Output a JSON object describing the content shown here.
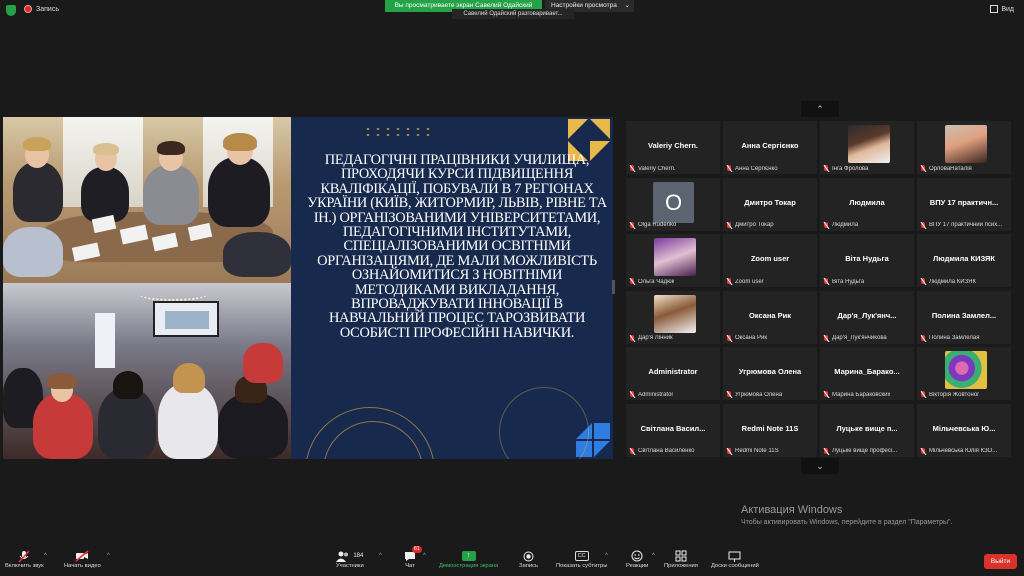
{
  "topbar": {
    "record_label": "Запись",
    "sharing_banner": "Вы просматриваете экран Савелий Одайский",
    "view_options": "Настройки просмотра",
    "speaking": "Савелий Одайский разговаривает...",
    "view_label": "Вид"
  },
  "slide": {
    "text": "Педагогічні працівники училища, проходячи курси підвищення кваліфікації, побували в 7 регіонах України (Київ, Житормир, Львів, Рівне та ін.) організованими університетами, педагогічними інститутами, спеціалізованими освітніми організаціями, де мали можливість ознайомитися з новітніми методиками викладання, впроваджувати інновації в навчальний процес таРозвивати особисті професійні навички.",
    "accent_color": "#e8b84a",
    "background_color": "#17294d"
  },
  "gallery": {
    "up_label": "⌃",
    "down_label": "⌄",
    "tiles": [
      {
        "center": "Valeriy Chern.",
        "footer": "Valeriy Chern."
      },
      {
        "center": "Анна Сергієнко",
        "footer": "Анна Сергієнко"
      },
      {
        "center": "",
        "footer": "Інга Фролова",
        "avatar": "photo"
      },
      {
        "center": "",
        "footer": "ОрловаНаталія",
        "avatar": "photo"
      },
      {
        "center": "",
        "footer": "Olga Rudenko",
        "avatar": "letter",
        "letter": "O"
      },
      {
        "center": "Дмитро Токар",
        "footer": "Дмитро Токар"
      },
      {
        "center": "Людмила",
        "footer": "Людмила"
      },
      {
        "center": "ВПУ 17 практичн...",
        "footer": "ВПУ 17 практичний псих..."
      },
      {
        "center": "",
        "footer": "Ольга Чадюк",
        "avatar": "photo"
      },
      {
        "center": "Zoom user",
        "footer": "Zoom user"
      },
      {
        "center": "Віта Нудьга",
        "footer": "Віта Нудьга"
      },
      {
        "center": "Людмила КИЗЯК",
        "footer": "Людмила КИЗЯК"
      },
      {
        "center": "",
        "footer": "Дар'я Лінник",
        "avatar": "photo"
      },
      {
        "center": "Оксана Рик",
        "footer": "Оксана Рик"
      },
      {
        "center": "Дар'я_Лук'янч...",
        "footer": "Дар'я_Лук'янчикова"
      },
      {
        "center": "Полина Замлел...",
        "footer": "Полина Замлелая"
      },
      {
        "center": "Administrator",
        "footer": "Administrator"
      },
      {
        "center": "Угрюмова Олена",
        "footer": "Угрюмова Олена"
      },
      {
        "center": "Марина_Барако...",
        "footer": "Марина Бараковских"
      },
      {
        "center": "",
        "footer": "Вікторія Жовтоног",
        "avatar": "art"
      },
      {
        "center": "Світлана Васил...",
        "footer": "Світлана Василенко"
      },
      {
        "center": "Redmi Note 11S",
        "footer": "Redmi Note 11S"
      },
      {
        "center": "Луцьке вище п...",
        "footer": "Луцьке вище професі..."
      },
      {
        "center": "Мільчевська Ю...",
        "footer": "Мільчевська Юлія КЗО..."
      }
    ]
  },
  "watermark": {
    "title": "Активация Windows",
    "subtitle": "Чтобы активировать Windows, перейдите в раздел \"Параметры\"."
  },
  "toolbar": {
    "mute": "Включить звук",
    "video": "Начать видео",
    "participants": "Участники",
    "participants_count": "184",
    "chat": "Чат",
    "chat_badge": "81",
    "share": "Демонстрация экрана",
    "record": "Запись",
    "captions": "Показать субтитры",
    "captions_icon": "CC",
    "reactions": "Реакции",
    "apps": "Приложения",
    "whiteboards": "Доски сообщений",
    "leave": "Выйти"
  }
}
